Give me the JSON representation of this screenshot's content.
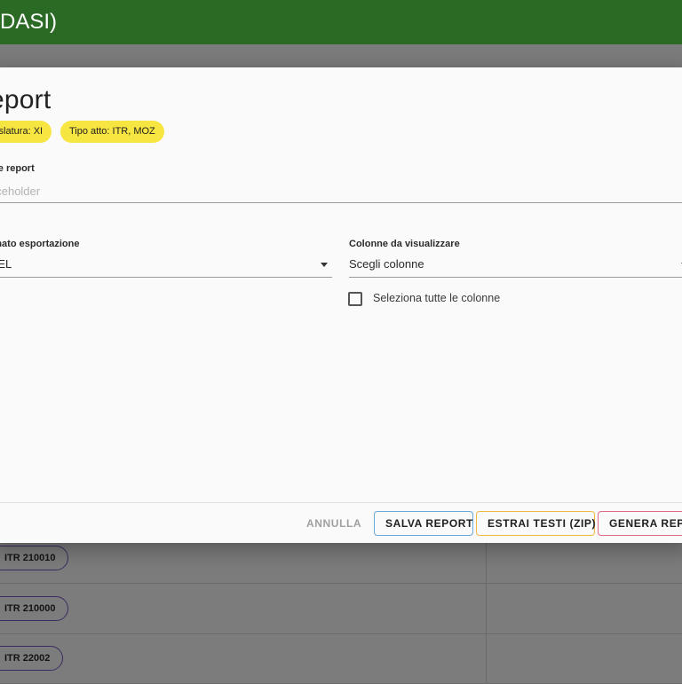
{
  "app": {
    "title": "-DASI)"
  },
  "background_rows": [
    {
      "label": "ITR 210010"
    },
    {
      "label": "ITR 210000"
    },
    {
      "label": "ITR 22002"
    }
  ],
  "dialog": {
    "title": "eport",
    "filters": [
      {
        "label": "gislatura: XI"
      },
      {
        "label": "Tipo atto: ITR, MOZ"
      }
    ],
    "name_field": {
      "label": "me report",
      "placeholder": "aceholder",
      "value": ""
    },
    "format_field": {
      "label": "rmato esportazione",
      "value": "CEL"
    },
    "columns_field": {
      "label": "Colonne da visualizzare",
      "value": "Scegli colonne"
    },
    "select_all": {
      "label": "Seleziona tutte le colonne",
      "checked": false
    },
    "actions": {
      "cancel": "ANNULLA",
      "save": "SALVA REPORT",
      "extract": "ESTRAI TESTI (ZIP)",
      "generate": "GENERA REPO"
    }
  },
  "colors": {
    "appbar": "#2a6a24",
    "chip": "#f7e641",
    "save_border": "#6aa8d6",
    "extract_border": "#f0b840",
    "generate_border": "#e36a86"
  },
  "icons": {
    "dropdown": "arrow-drop-down-icon",
    "checkbox": "checkbox-unchecked-icon"
  }
}
